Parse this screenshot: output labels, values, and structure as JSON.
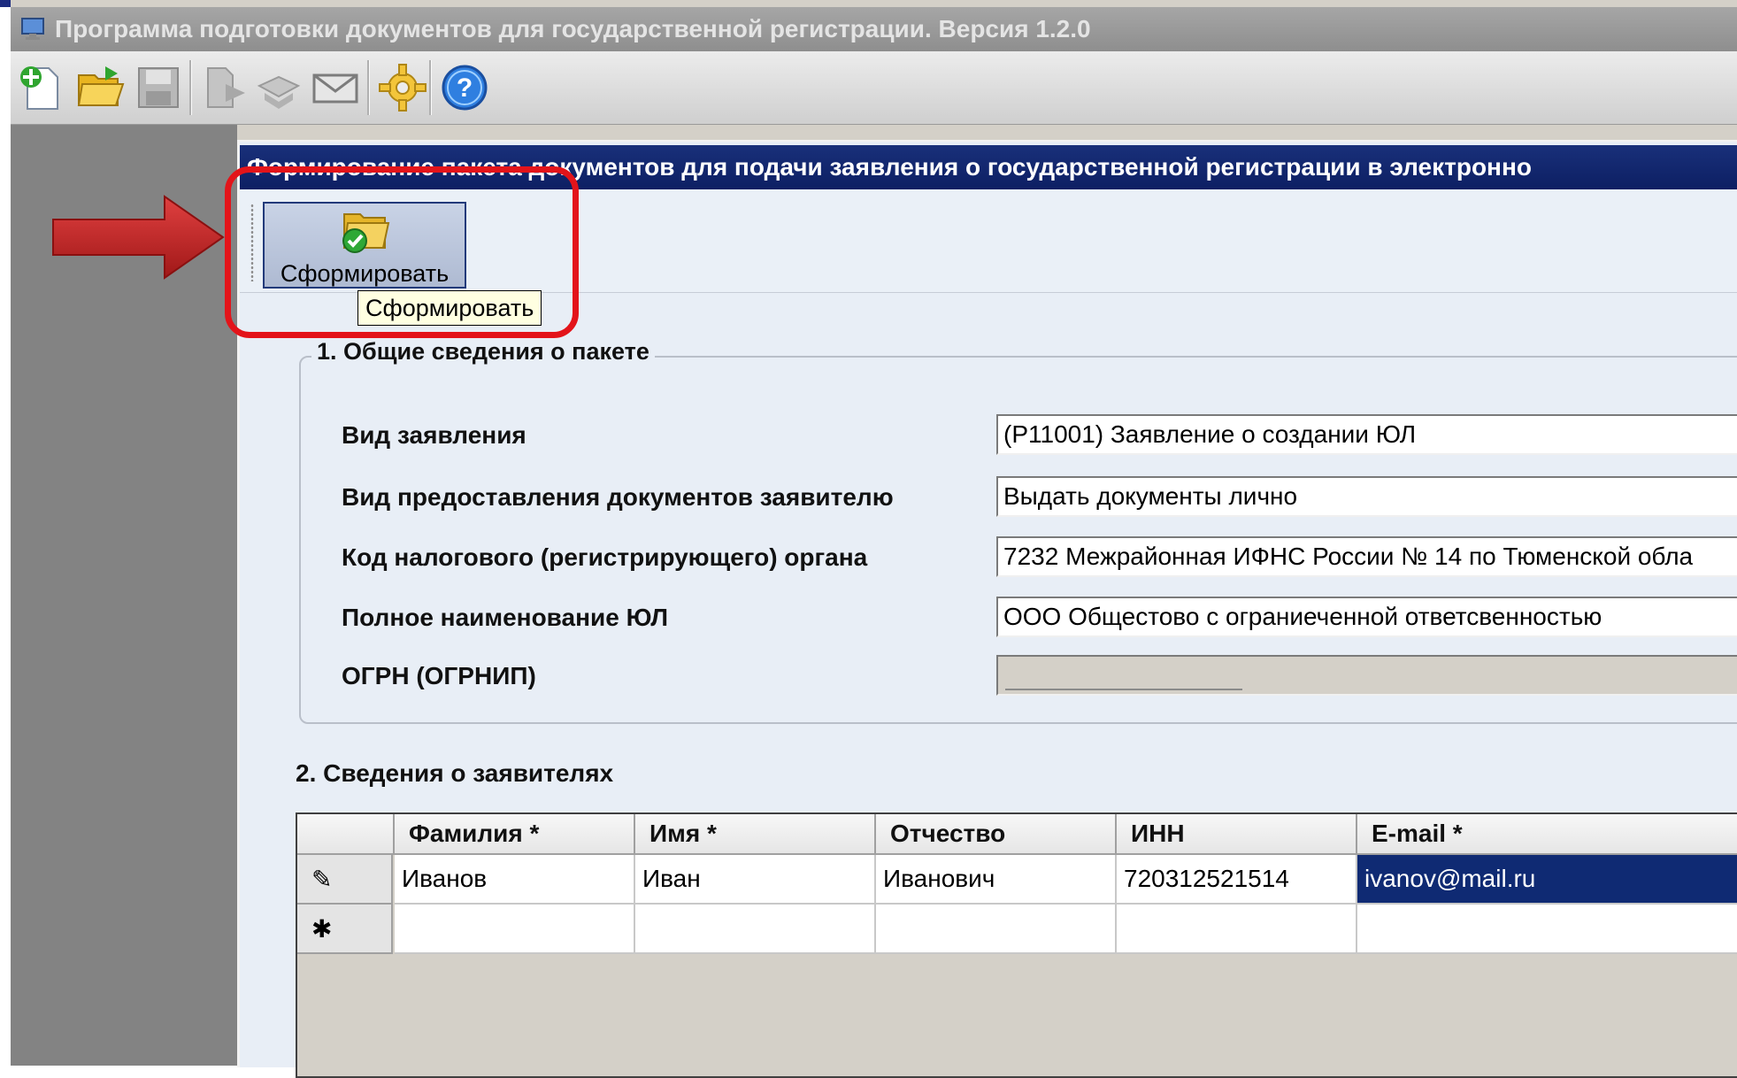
{
  "app": {
    "title": "Программа подготовки документов для государственной регистрации. Версия 1.2.0"
  },
  "toolbar": {
    "icons": [
      "new-document-icon",
      "open-folder-icon",
      "save-icon",
      "export-icon",
      "print-icon",
      "mail-icon",
      "settings-icon",
      "help-icon"
    ]
  },
  "child": {
    "title": "Формирование пакета документов для подачи заявления о государственной регистрации в электронно",
    "form_button_label": "Сформировать",
    "tooltip": "Сформировать"
  },
  "section1": {
    "legend": "1. Общие сведения о пакете",
    "fields": [
      {
        "label": "Вид заявления",
        "value": "(Р11001) Заявление о создании ЮЛ"
      },
      {
        "label": "Вид предоставления документов заявителю",
        "value": "Выдать документы лично"
      },
      {
        "label": "Код налогового (регистрирующего) органа",
        "value": "7232 Межрайонная ИФНС России № 14 по Тюменской обла"
      },
      {
        "label": "Полное наименование ЮЛ",
        "value": "ООО Общестово с ограниеченной ответсвенностью"
      },
      {
        "label": "ОГРН (ОГРНИП)",
        "value": ""
      }
    ]
  },
  "section2": {
    "title": "2. Сведения о заявителях",
    "columns": [
      "Фамилия *",
      "Имя *",
      "Отчество",
      "ИНН",
      "E-mail *"
    ],
    "rows": [
      {
        "marker": "✎",
        "cells": [
          "Иванов",
          "Иван",
          "Иванович",
          "720312521514",
          "ivanov@mail.ru"
        ]
      },
      {
        "marker": "✱",
        "cells": [
          "",
          "",
          "",
          "",
          ""
        ]
      }
    ]
  },
  "colors": {
    "title_bar": "#8e8e8e",
    "child_title": "#0d1f63",
    "selection": "#0f2a73",
    "annotation_red": "#e3141a"
  }
}
